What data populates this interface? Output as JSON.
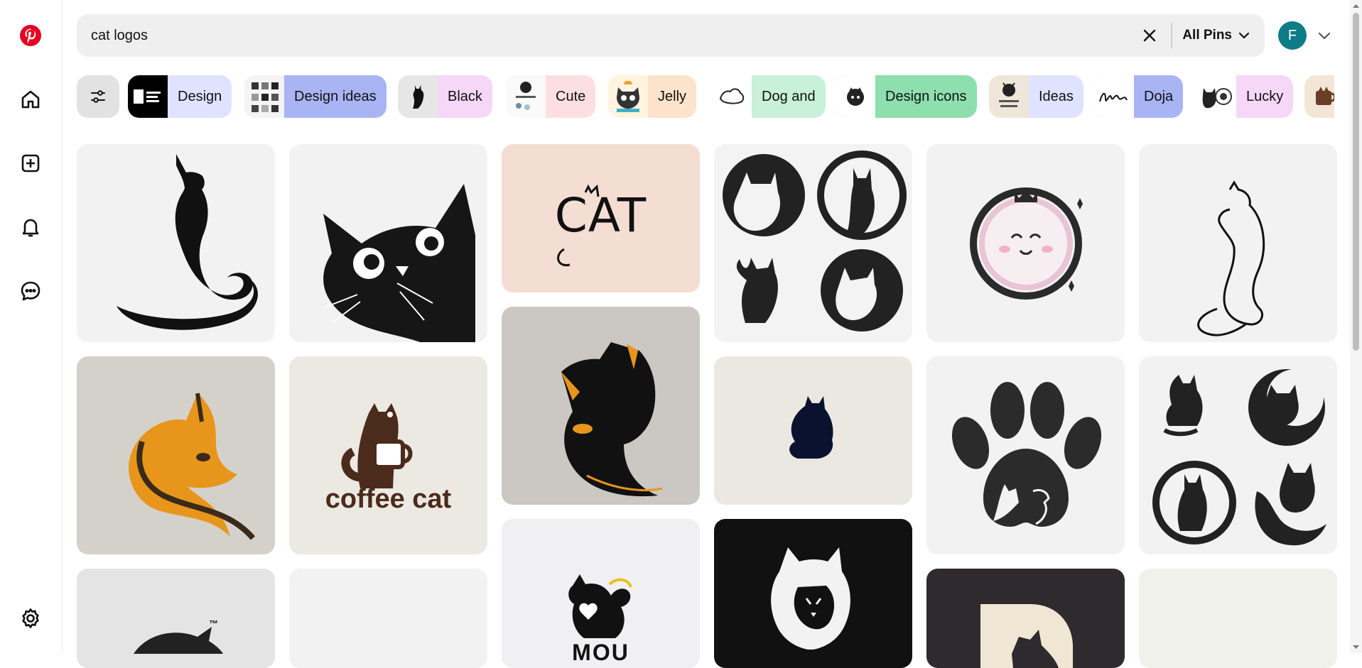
{
  "search": {
    "query": "cat logos",
    "scope_label": "All Pins"
  },
  "account": {
    "initial": "F"
  },
  "chips": [
    {
      "label": "Design",
      "color": "#dfe3ff"
    },
    {
      "label": "Design ideas",
      "color": "#a9b4f5"
    },
    {
      "label": "Black",
      "color": "#f6d7f7"
    },
    {
      "label": "Cute",
      "color": "#fddfe2"
    },
    {
      "label": "Jelly",
      "color": "#fde3cc"
    },
    {
      "label": "Dog and",
      "color": "#c9f0d8"
    },
    {
      "label": "Design icons",
      "color": "#8ddfae"
    },
    {
      "label": "Ideas",
      "color": "#dfe3ff"
    },
    {
      "label": "Doja",
      "color": "#a9b4f5"
    },
    {
      "label": "Lucky",
      "color": "#f6d7f7"
    }
  ],
  "pins": [
    {
      "subject": "sitting cat silhouette",
      "bg": "#f2f2f2"
    },
    {
      "subject": "peeking cat",
      "bg": "#f2f2f2"
    },
    {
      "subject": "cat wordmark",
      "bg": "#f4ddd3",
      "text": "CAT"
    },
    {
      "subject": "four cat circle logos",
      "bg": "#f3f3f3"
    },
    {
      "subject": "smiling cat crown badge",
      "bg": "#f2f2f2"
    },
    {
      "subject": "line art cat",
      "bg": "#f2f2f2"
    },
    {
      "subject": "orange cat head",
      "bg": "#d4d1cb"
    },
    {
      "subject": "coffee cat logo",
      "bg": "#ece8e2",
      "text": "coffee cat"
    },
    {
      "subject": "black cat head",
      "bg": "#cbc7c2"
    },
    {
      "subject": "small navy cat",
      "bg": "#ebe8e2"
    },
    {
      "subject": "paw with cat and dog",
      "bg": "#f2f2f2"
    },
    {
      "subject": "four cat moon logos",
      "bg": "#f2f2f2"
    },
    {
      "subject": "cat logo trademark",
      "bg": "#e4e4e4",
      "text": "™"
    },
    {
      "subject": "blank pin",
      "bg": "#f2f2f2"
    },
    {
      "subject": "cat heart logo",
      "bg": "#f0f0f2",
      "text": "MOU"
    },
    {
      "subject": "hooded cat",
      "bg": "#111111"
    },
    {
      "subject": "cat in letter D",
      "bg": "#2f2a2d"
    },
    {
      "subject": "blank pin",
      "bg": "#f1f1ec"
    }
  ]
}
